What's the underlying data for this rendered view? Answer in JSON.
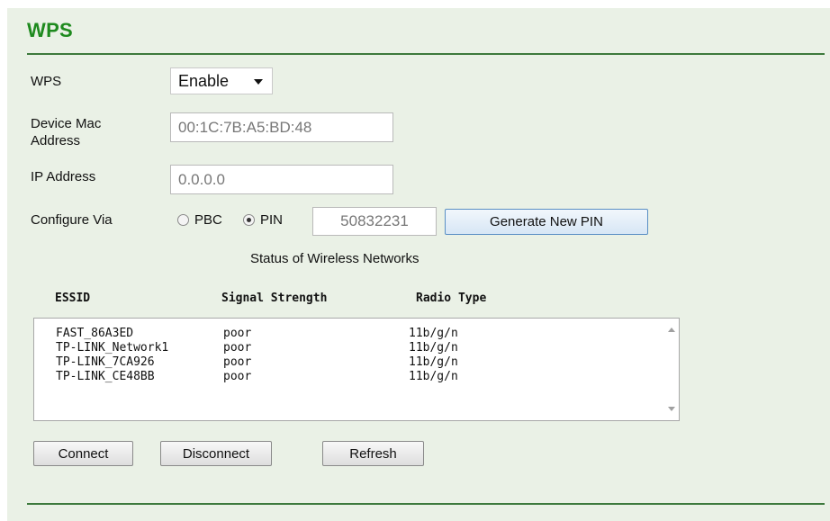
{
  "section": {
    "title": "WPS"
  },
  "wps": {
    "label": "WPS",
    "selected": "Enable"
  },
  "device_mac": {
    "label_line1": "Device Mac",
    "label_line2": "Address",
    "value": "00:1C:7B:A5:BD:48"
  },
  "ip_address": {
    "label": "IP Address",
    "value": "0.0.0.0"
  },
  "configure_via": {
    "label": "Configure Via",
    "options": [
      {
        "label": "PBC",
        "checked": false
      },
      {
        "label": "PIN",
        "checked": true
      }
    ],
    "pin_value": "50832231",
    "generate_label": "Generate New PIN"
  },
  "networks": {
    "heading": "Status of Wireless Networks",
    "columns": [
      "ESSID",
      "Signal Strength",
      "Radio Type"
    ],
    "rows": [
      {
        "essid": "FAST_86A3ED",
        "signal": "poor",
        "radio": "11b/g/n"
      },
      {
        "essid": "TP-LINK_Network1",
        "signal": "poor",
        "radio": "11b/g/n"
      },
      {
        "essid": "TP-LINK_7CA926",
        "signal": "poor",
        "radio": "11b/g/n"
      },
      {
        "essid": "TP-LINK_CE48BB",
        "signal": "poor",
        "radio": "11b/g/n"
      }
    ]
  },
  "actions": {
    "connect": "Connect",
    "disconnect": "Disconnect",
    "refresh": "Refresh"
  },
  "colors": {
    "panel_bg": "#eaf1e6",
    "title": "#1e8a1e",
    "rule": "#3d7a3d"
  }
}
